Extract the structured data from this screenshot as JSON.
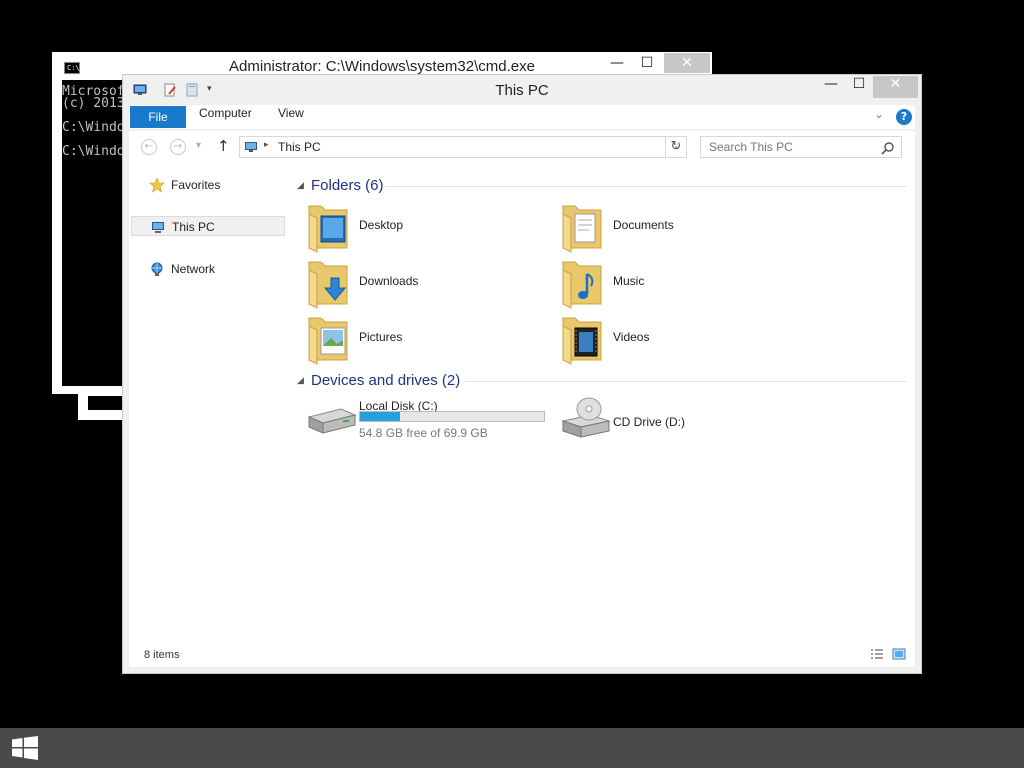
{
  "cmd": {
    "title": "Administrator: C:\\Windows\\system32\\cmd.exe",
    "icon_label": "C:\\.",
    "lines": [
      "Microsof",
      "(c) 2013",
      "",
      "C:\\Windo",
      "",
      "C:\\Windo"
    ],
    "controls": {
      "minimize": "—",
      "maximize": "☐",
      "close": "✕"
    }
  },
  "explorer": {
    "title": "This PC",
    "controls": {
      "minimize": "—",
      "maximize": "☐",
      "close": "✕"
    },
    "ribbon": {
      "tabs": [
        "File",
        "Computer",
        "View"
      ],
      "expand_icon": "chevron-down-icon",
      "help_label": "?"
    },
    "address": {
      "back": "←",
      "forward": "→",
      "recent": "▾",
      "up": "↑",
      "path": "This PC",
      "separator": "▸",
      "dropdown": "⌄",
      "refresh": "↻",
      "search_placeholder": "Search This PC"
    },
    "nav_pane": {
      "items": [
        {
          "label": "Favorites",
          "icon": "star-icon"
        },
        {
          "label": "This PC",
          "icon": "computer-icon",
          "selected": true
        },
        {
          "label": "Network",
          "icon": "network-icon"
        }
      ]
    },
    "groups": {
      "folders": {
        "title": "Folders (6)",
        "items": [
          {
            "name": "Desktop",
            "icon": "desktop-folder-icon"
          },
          {
            "name": "Documents",
            "icon": "documents-folder-icon"
          },
          {
            "name": "Downloads",
            "icon": "downloads-folder-icon"
          },
          {
            "name": "Music",
            "icon": "music-folder-icon"
          },
          {
            "name": "Pictures",
            "icon": "pictures-folder-icon"
          },
          {
            "name": "Videos",
            "icon": "videos-folder-icon"
          }
        ]
      },
      "devices": {
        "title": "Devices and drives (2)",
        "items": [
          {
            "name": "Local Disk (C:)",
            "free_text": "54.8 GB free of 69.9 GB",
            "used_fraction": 0.216,
            "icon": "hard-disk-icon"
          },
          {
            "name": "CD Drive (D:)",
            "icon": "cd-drive-icon"
          }
        ]
      }
    },
    "status": {
      "items_count": "8 items",
      "view_buttons": [
        "details-view-icon",
        "large-icons-view-icon"
      ]
    },
    "colors": {
      "accent": "#1979ca",
      "group_title": "#1e3287",
      "drive_bar": "#26a0da"
    }
  },
  "taskbar": {
    "start_icon": "windows-logo-icon"
  }
}
